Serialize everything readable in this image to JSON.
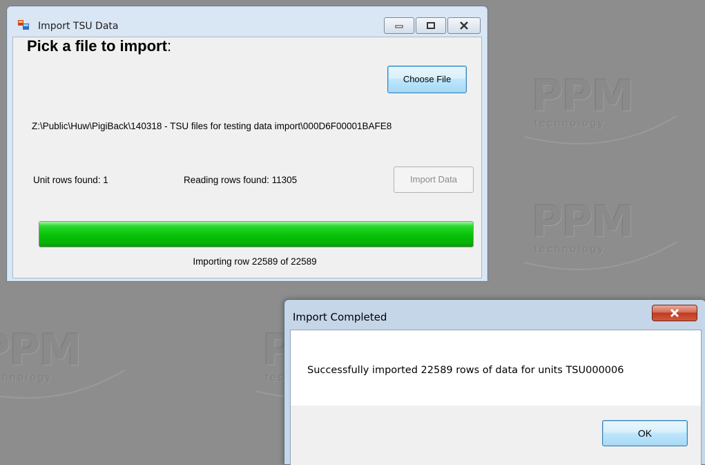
{
  "desktop": {
    "watermark": {
      "logo": "PPM",
      "tagline": "technology"
    }
  },
  "main_window": {
    "title": "Import TSU Data",
    "heading": "Pick a file to import",
    "heading_colon": ":",
    "choose_file_label": "Choose File",
    "file_path": "Z:\\Public\\Huw\\PigiBack\\140318 - TSU files for testing data import\\000D6F00001BAFE8",
    "unit_rows": "Unit rows found: 1",
    "reading_rows": "Reading rows found: 11305",
    "import_data_label": "Import Data",
    "import_data_enabled": false,
    "progress": {
      "value": 1.0,
      "color": "#06c106"
    },
    "progress_text": "Importing row 22589 of 22589",
    "caption_buttons": [
      "minimize-icon",
      "maximize-icon",
      "close-icon"
    ]
  },
  "dialog": {
    "title": "Import Completed",
    "message": "Successfully imported 22589 rows of data for units TSU000006",
    "ok_label": "OK",
    "close_icon": "close-icon",
    "close_color": "#c23a1f"
  }
}
